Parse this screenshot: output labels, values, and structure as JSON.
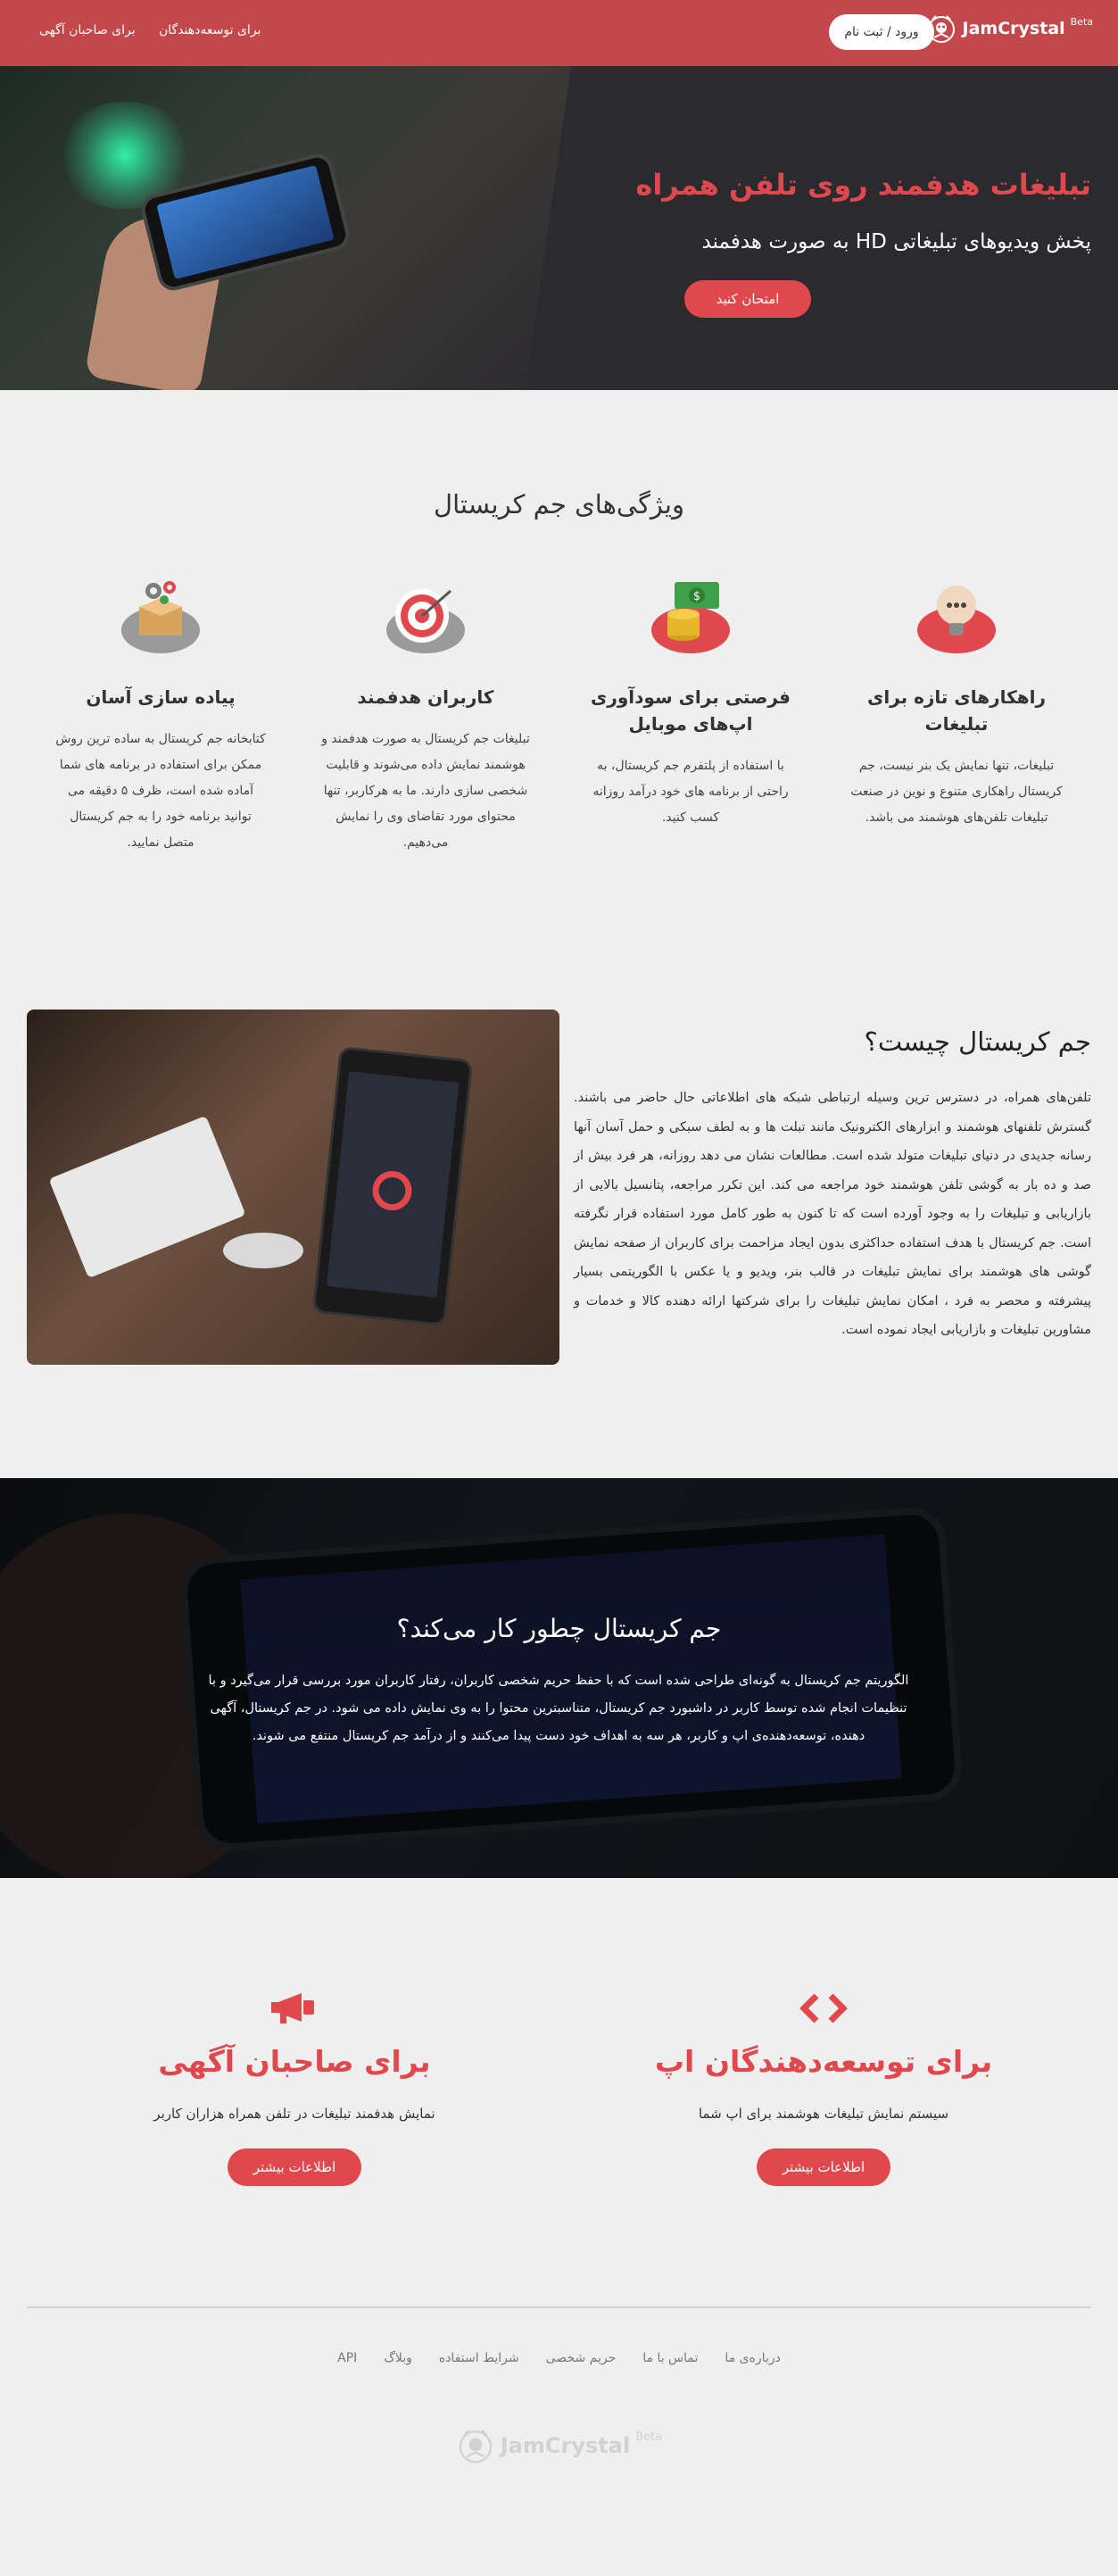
{
  "nav": {
    "brand_name": "JamCrystal",
    "brand_beta": "Beta",
    "login_label": "ورود / ثبت نام",
    "links": [
      "برای توسعه‌دهندگان",
      "برای صاحبان آگهی"
    ]
  },
  "hero": {
    "title": "تبلیغات هدفمند روی تلفن همراه",
    "subtitle": "پخش ویدیوهای تبلیغاتی HD به صورت هدفمند",
    "cta_label": "امتحان کنید"
  },
  "features": {
    "section_title": "ویژگی‌های جم کریستال",
    "items": [
      {
        "icon": "lightbulb-icon",
        "title": "راهکارهای تازه برای تبلیغات",
        "text": "تبلیغات، تنها نمایش یک بنر نیست، جم کریستال راهکاری متنوع و نوین در صنعت تبلیغات تلفن‌های هوشمند می باشد."
      },
      {
        "icon": "money-coins-icon",
        "title": "فرصتی برای سودآوری اپ‌های موبایل",
        "text": "با استفاده از پلتفرم جم کریستال، به راحتی از برنامه های خود درآمد روزانه کسب کنید."
      },
      {
        "icon": "target-icon",
        "title": "کاربران هدفمند",
        "text": "تبلیغات جم کریستال به صورت هدفمند و هوشمند نمایش داده می‌شوند و قابلیت شخصی سازی دارند. ما به هرکاربر، تنها محتوای مورد تقاضای وی را نمایش می‌دهیم."
      },
      {
        "icon": "box-gears-icon",
        "title": "پیاده سازی آسان",
        "text": "کتابخانه جم کریستال به ساده ترین روش ممکن برای استفاده در برنامه های شما آماده شده است، ظرف ۵ دقیقه می توانید برنامه خود را به جم کریستال متصل نمایید."
      }
    ]
  },
  "what": {
    "title": "جم کریستال چیست؟",
    "text": "تلفن‌های همراه، در دسترس ترین وسیله ارتباطی شبکه های اطلاعاتی حال حاضر می باشند. گسترش تلفنهای هوشمند و ابزارهای الکترونیک مانند تبلت ها و به لطف سبکی و حمل آسان آنها رسانه جدیدی در دنیای تبلیغات متولد شده است. مطالعات نشان می دهد روزانه، هر فرد بیش از صد و ده بار به گوشی تلفن هوشمند خود مراجعه می کند. این تکرر مراجعه، پتانسیل بالایی از بازاریابی و تبلیغات را به وجود آورده است که تا کنون به طور کامل مورد استفاده قرار نگرفته است. جم کریستال با هدف استفاده حداکثری بدون ایجاد مزاحمت برای کاربران از صفحه نمایش گوشی های هوشمند برای نمایش تبلیغات در قالب بنر، ویدیو و یا عکس با الگوریتمی بسیار پیشرفته و محصر به فرد ، امکان نمایش تبلیغات را برای شرکتها ارائه دهنده کالا و خدمات و مشاورین تبلیغات و بازاریابی ایجاد نموده است."
  },
  "how": {
    "title": "جم کریستال چطور کار می‌کند؟",
    "text": "الگوریتم جم کریستال به گونه‌ای طراحی شده است که با حفظ حریم شخصی کاربران، رفتار کاربران مورد بررسی قرار می‌گیرد و با تنظیمات انجام شده توسط کاربر در داشبورد جم کریستال، متناسبترین محتوا را به وی نمایش داده می شود. در جم کریستال، آگهی دهنده، توسعه‌دهنده‌ی اپ و کاربر، هر سه به اهداف خود دست پیدا می‌کنند و از درآمد جم کریستال منتفع می شوند."
  },
  "cta": {
    "developers": {
      "icon": "code-brackets-icon",
      "title": "برای توسعه‌دهندگان اپ",
      "text": "سیستم نمایش تبلیغات هوشمند برای اپ شما",
      "button": "اطلاعات بیشتر"
    },
    "advertisers": {
      "icon": "megaphone-icon",
      "title": "برای صاحبان آگهی",
      "text": "نمایش هدفمند تبلیغات در تلفن همراه هزاران کاربر",
      "button": "اطلاعات بیشتر"
    }
  },
  "footer": {
    "links": [
      "درباره‌ی ما",
      "تماس با ما",
      "حریم شخصی",
      "شرایط استفاده",
      "وبلاگ",
      "API"
    ],
    "brand_name": "JamCrystal",
    "brand_beta": "Beta"
  },
  "colors": {
    "accent": "#e0484d",
    "nav": "#c4474b",
    "background": "#efefef"
  }
}
